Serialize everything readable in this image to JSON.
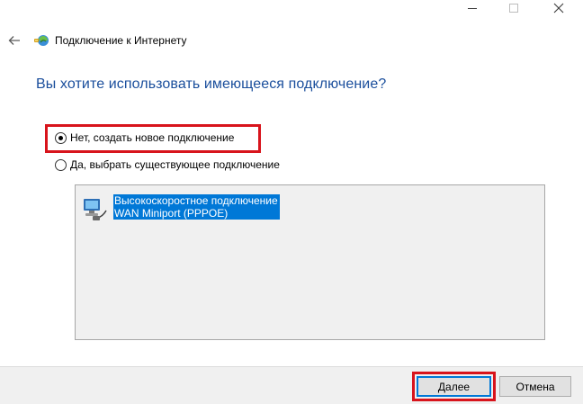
{
  "window": {
    "title": "Подключение к Интернету",
    "controls": {
      "minimize": "minimize-icon",
      "maximize": "maximize-icon",
      "close": "close-icon"
    }
  },
  "header": {
    "back_icon": "back-arrow-icon",
    "app_icon": "internet-connection-icon",
    "title": "Подключение к Интернету"
  },
  "main": {
    "heading": "Вы хотите использовать имеющееся подключение?",
    "options": [
      {
        "label": "Нет, создать новое подключение",
        "checked": true
      },
      {
        "label": "Да, выбрать существующее подключение",
        "checked": false
      }
    ],
    "connections": [
      {
        "name": "Высокоскоростное подключение",
        "device": "WAN Miniport (PPPOE)",
        "icon": "network-connection-icon",
        "selected": true
      }
    ]
  },
  "footer": {
    "next_label": "Далее",
    "cancel_label": "Отмена"
  },
  "colors": {
    "heading": "#1a4e9c",
    "selection": "#0078d7",
    "highlight": "#d8141c"
  }
}
